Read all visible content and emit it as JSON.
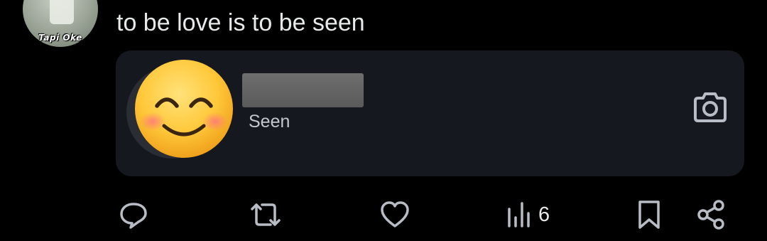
{
  "post": {
    "avatar_caption": "Tapi Oke",
    "text": "to be love is to be seen"
  },
  "card": {
    "status": "Seen",
    "emoji": "smiling-face-emoji",
    "icons": {
      "camera": "camera-icon"
    }
  },
  "actions": {
    "reply_icon": "reply-icon",
    "repost_icon": "repost-icon",
    "like_icon": "heart-icon",
    "views_icon": "views-icon",
    "views_count": "6",
    "bookmark_icon": "bookmark-icon",
    "share_icon": "share-icon"
  },
  "colors": {
    "background": "#000000",
    "card": "#16181f",
    "text": "#e7e9ea",
    "icon": "#b8bcc4"
  }
}
